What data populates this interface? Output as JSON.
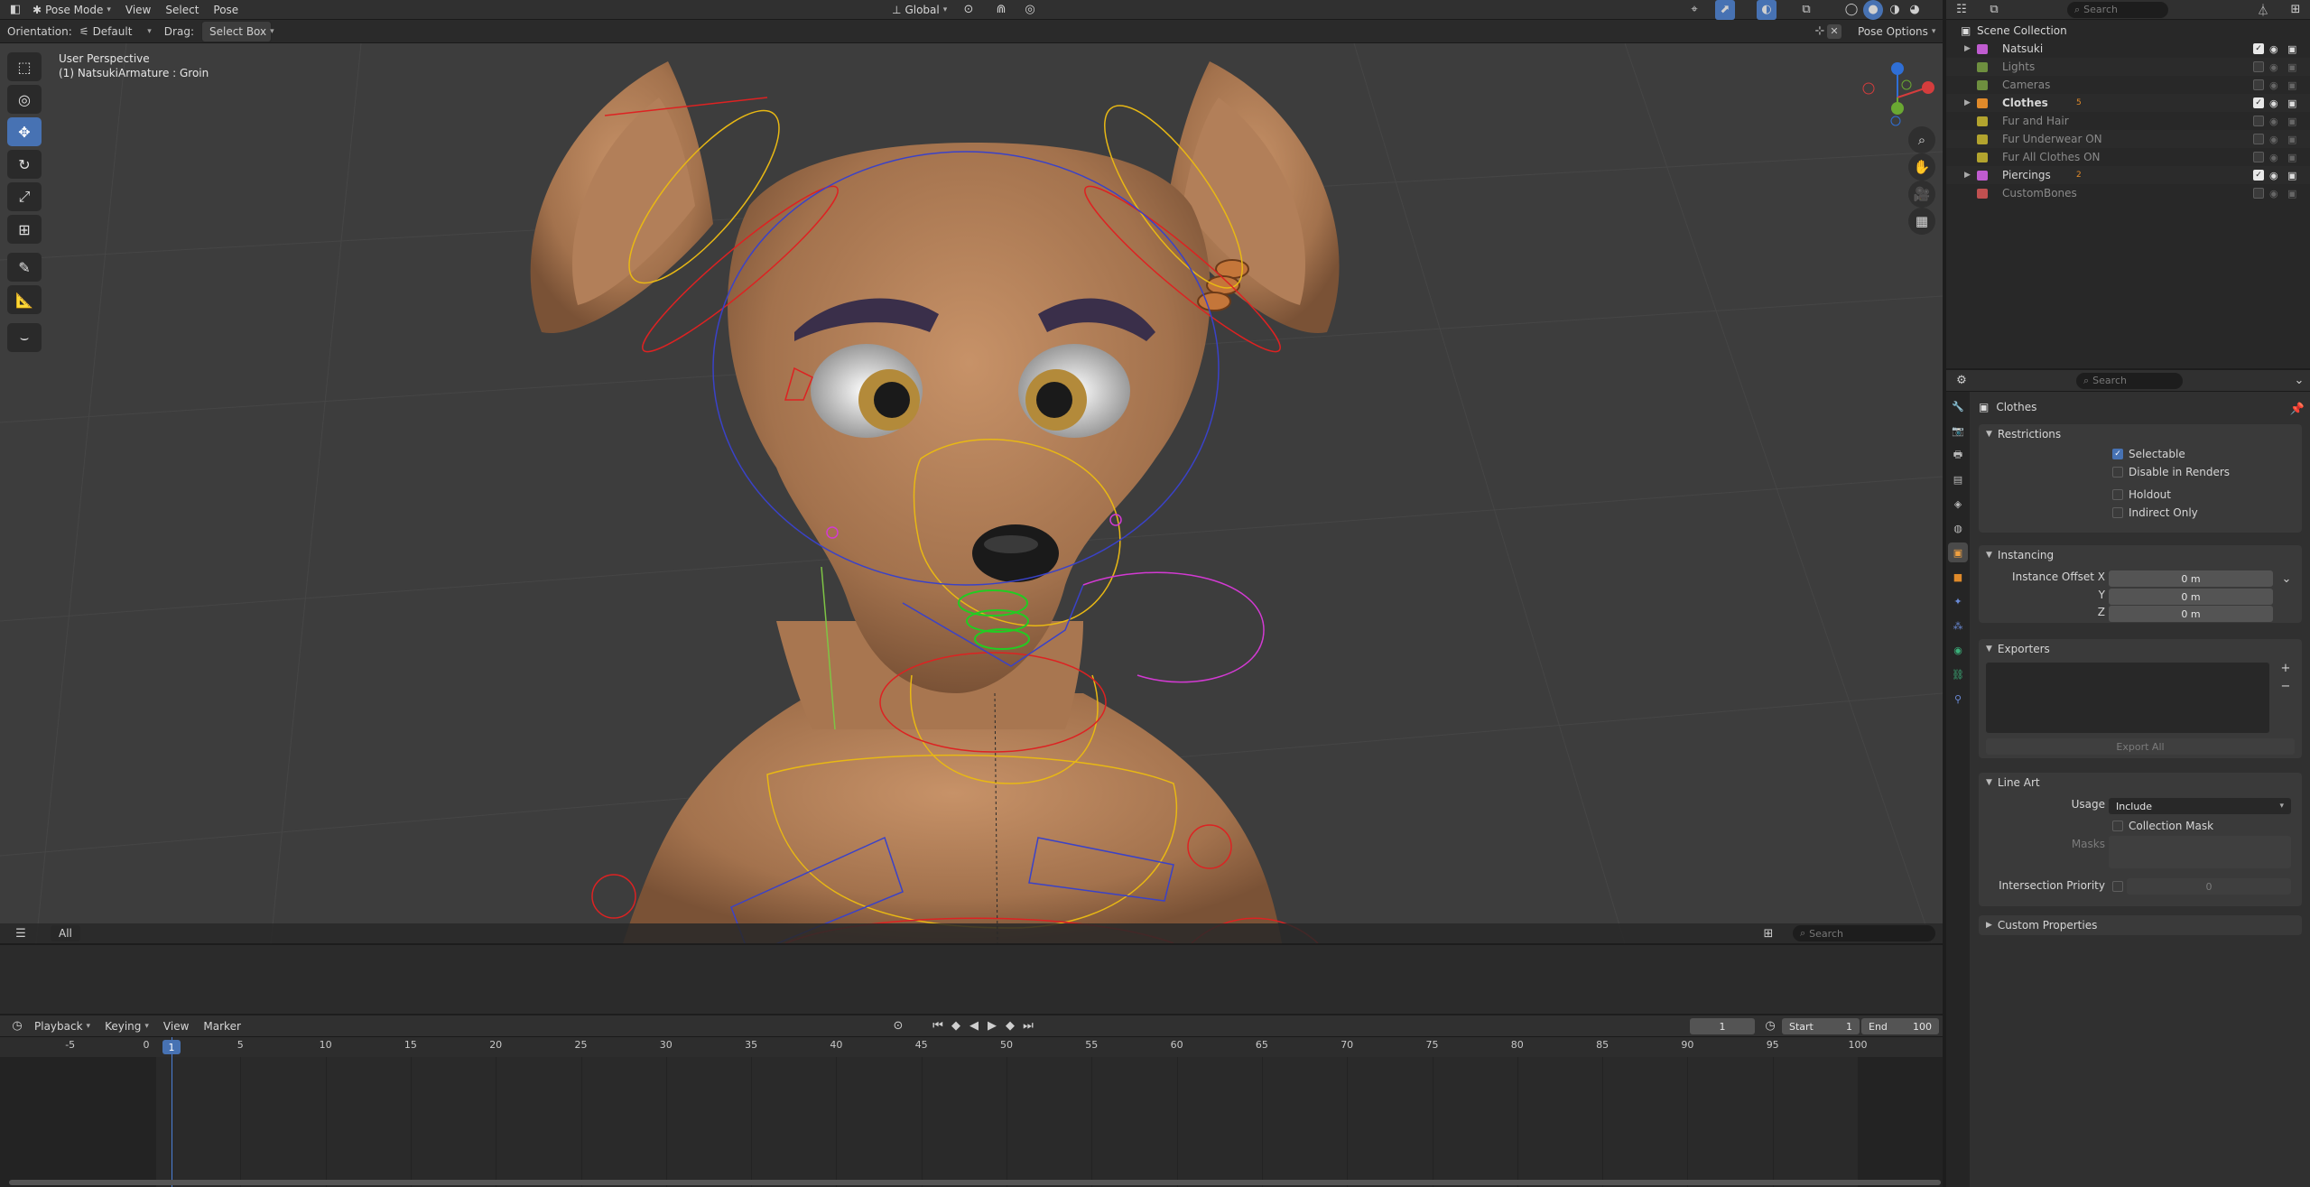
{
  "top_header": {
    "mode": "Pose Mode",
    "menus": [
      "View",
      "Select",
      "Pose"
    ],
    "transform_orientation": "Global",
    "search_placeholder": "Search"
  },
  "tool_header": {
    "orientation_label": "Orientation:",
    "orientation_value": "Default",
    "drag_label": "Drag:",
    "drag_value": "Select Box",
    "pose_options": "Pose Options"
  },
  "viewport": {
    "perspective": "User Perspective",
    "active_object": "(1) NatsukiArmature : Groin",
    "filter_label": "All",
    "search_placeholder": "Search"
  },
  "outliner": {
    "search_placeholder": "Search",
    "root": "Scene Collection",
    "items": [
      {
        "name": "Natsuki",
        "color": "#c05cd0",
        "enabled": true,
        "expandable": true
      },
      {
        "name": "Lights",
        "color": "#6e8f3f",
        "enabled": false,
        "expandable": false
      },
      {
        "name": "Cameras",
        "color": "#6e8f3f",
        "enabled": false,
        "expandable": false
      },
      {
        "name": "Clothes",
        "color": "#e08a2a",
        "enabled": true,
        "expandable": true,
        "badge": "5"
      },
      {
        "name": "Fur and Hair",
        "color": "#b3a42e",
        "enabled": false,
        "expandable": false
      },
      {
        "name": "Fur Underwear ON",
        "color": "#b3a42e",
        "enabled": false,
        "expandable": false
      },
      {
        "name": "Fur All Clothes ON",
        "color": "#b3a42e",
        "enabled": false,
        "expandable": false
      },
      {
        "name": "Piercings",
        "color": "#c05cd0",
        "enabled": true,
        "expandable": true,
        "badge": "2"
      },
      {
        "name": "CustomBones",
        "color": "#c05050",
        "enabled": false,
        "expandable": false
      }
    ]
  },
  "properties": {
    "search_placeholder": "Search",
    "context_name": "Clothes",
    "restrictions": {
      "title": "Restrictions",
      "selectable": "Selectable",
      "disable_in_renders": "Disable in Renders",
      "holdout": "Holdout",
      "indirect_only": "Indirect Only"
    },
    "instancing": {
      "title": "Instancing",
      "offset_x_label": "Instance Offset X",
      "y_label": "Y",
      "z_label": "Z",
      "x_value": "0 m",
      "y_value": "0 m",
      "z_value": "0 m"
    },
    "exporters": {
      "title": "Exporters",
      "export_all": "Export All"
    },
    "line_art": {
      "title": "Line Art",
      "usage_label": "Usage",
      "usage_value": "Include",
      "collection_mask": "Collection Mask",
      "masks_label": "Masks",
      "intersection_priority_label": "Intersection Priority",
      "intersection_priority_value": "0"
    },
    "custom_properties": "Custom Properties"
  },
  "timeline": {
    "menus": [
      "Playback",
      "Keying",
      "View",
      "Marker"
    ],
    "current_frame": "1",
    "start_label": "Start",
    "start_value": "1",
    "end_label": "End",
    "end_value": "100",
    "ticks": [
      "-5",
      "0",
      "5",
      "10",
      "15",
      "20",
      "25",
      "30",
      "35",
      "40",
      "45",
      "50",
      "55",
      "60",
      "65",
      "70",
      "75",
      "80",
      "85",
      "90",
      "95",
      "100"
    ]
  }
}
